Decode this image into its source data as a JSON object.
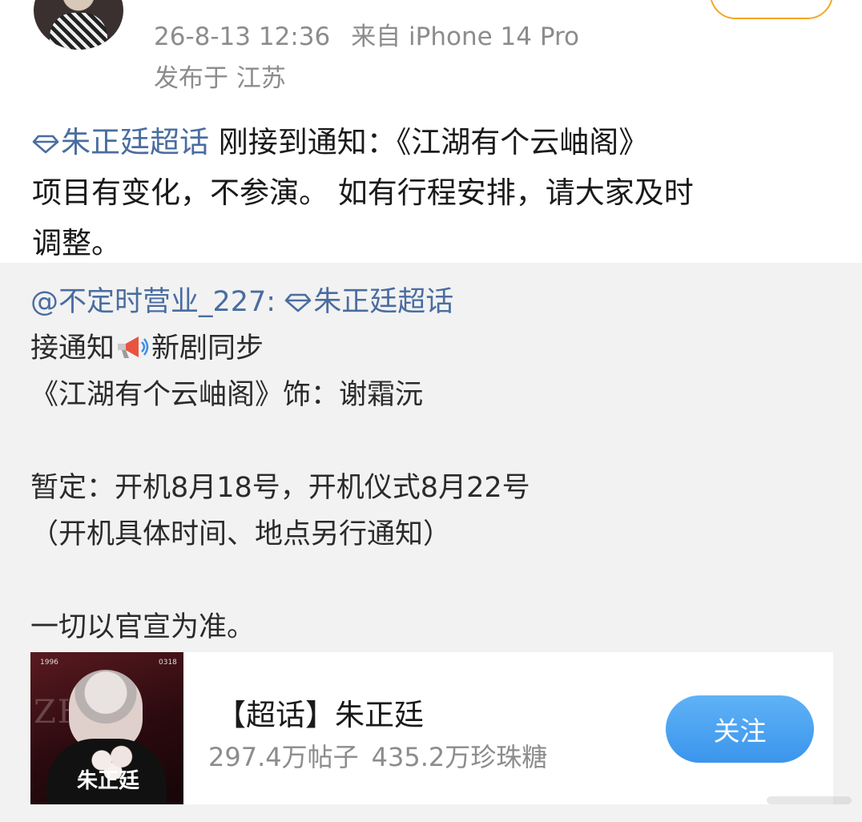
{
  "header": {
    "timestamp": "26-8-13 12:36",
    "source": "来自 iPhone 14 Pro",
    "location": "发布于 江苏"
  },
  "post": {
    "topic": "朱正廷超话",
    "text_line1": " 刚接到通知：《江湖有个云岫阁》",
    "text_line2": "项目有变化，不参演。 如有行程安排，请大家及时",
    "text_line3": "调整。"
  },
  "repost": {
    "mention": "@不定时营业_227:",
    "topic": "朱正廷超话",
    "line_notice_a": "接通知",
    "line_notice_b": "新剧同步",
    "line_role": "《江湖有个云岫阁》饰：谢霜沅",
    "line_schedule": "暂定：开机8月18号，开机仪式8月22号",
    "line_note": "（开机具体时间、地点另行通知）",
    "line_official": "一切以官宣为准。"
  },
  "card": {
    "title": "【超话】朱正廷",
    "posts": "297.4万帖子",
    "candy": "435.2万珍珠糖",
    "follow_label": "关注",
    "image_text": {
      "year": "1996",
      "code": "0318",
      "zhu": "ZHU",
      "name": "朱正廷"
    }
  },
  "colors": {
    "topic_blue": "#4a6da0",
    "meta_gray": "#8c8c8c",
    "repost_bg": "#f2f2f2",
    "follow_blue": "#3b95ec",
    "follow_outline_orange": "#f5a623"
  },
  "icons": {
    "topic": "diamond-icon",
    "megaphone": "megaphone-icon"
  }
}
